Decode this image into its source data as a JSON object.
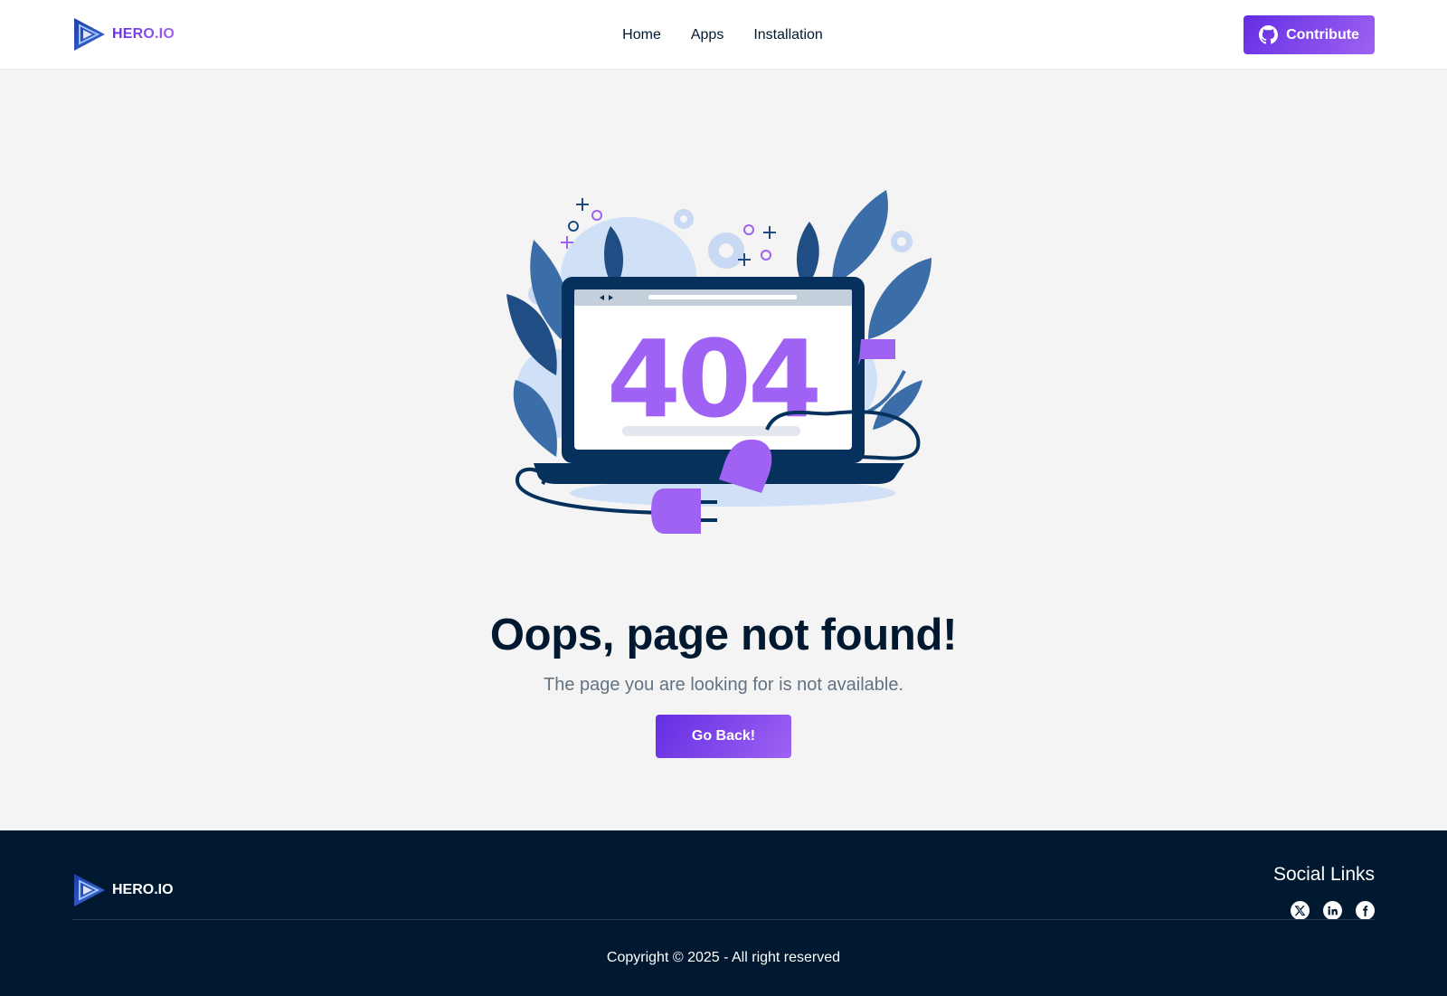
{
  "header": {
    "brand": "HERO.IO",
    "nav": [
      {
        "label": "Home"
      },
      {
        "label": "Apps"
      },
      {
        "label": "Installation"
      }
    ],
    "contribute_label": "Contribute"
  },
  "main": {
    "illustration_text": "404",
    "title": "Oops, page not found!",
    "subtitle": "The page you are looking for is not available.",
    "back_label": "Go Back!"
  },
  "footer": {
    "brand": "HERO.IO",
    "social_title": "Social Links",
    "social": [
      {
        "icon": "x-icon"
      },
      {
        "icon": "linkedin-icon"
      },
      {
        "icon": "facebook-icon"
      }
    ],
    "copyright": "Copyright © 2025 - All right reserved"
  },
  "colors": {
    "accent_start": "#632ee3",
    "accent_end": "#9f62f2",
    "dark": "#001931",
    "page_bg": "#f4f4f4",
    "muted_text": "#627382"
  }
}
